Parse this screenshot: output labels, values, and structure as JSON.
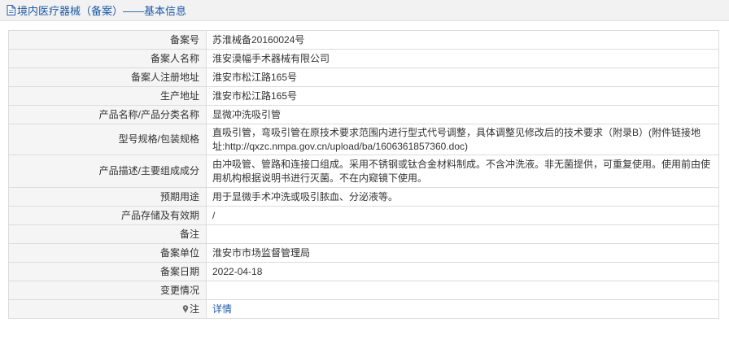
{
  "header": {
    "title": "境内医疗器械（备案）——基本信息"
  },
  "rows": [
    {
      "label": "备案号",
      "value": "苏淮械备20160024号"
    },
    {
      "label": "备案人名称",
      "value": "淮安漠幅手术器械有限公司"
    },
    {
      "label": "备案人注册地址",
      "value": "淮安市松江路165号"
    },
    {
      "label": "生产地址",
      "value": "淮安市松江路165号"
    },
    {
      "label": "产品名称/产品分类名称",
      "value": "显微冲洗吸引管"
    },
    {
      "label": "型号规格/包装规格",
      "value": "直吸引管，弯吸引管在原技术要求范围内进行型式代号调整，具体调整见修改后的技术要求（附录B）(附件链接地址:http://qxzc.nmpa.gov.cn/upload/ba/1606361857360.doc)"
    },
    {
      "label": "产品描述/主要组成成分",
      "value": "由冲吸管、管路和连接口组成。采用不锈钢或钛合金材料制成。不含冲洗液。非无菌提供，可重复使用。使用前由使用机构根据说明书进行灭菌。不在内窥镜下使用。"
    },
    {
      "label": "预期用途",
      "value": "用于显微手术冲洗或吸引脓血、分泌液等。"
    },
    {
      "label": "产品存储及有效期",
      "value": "/"
    },
    {
      "label": "备注",
      "value": ""
    },
    {
      "label": "备案单位",
      "value": "淮安市市场监督管理局"
    },
    {
      "label": "备案日期",
      "value": "2022-04-18"
    },
    {
      "label": "变更情况",
      "value": ""
    },
    {
      "label": "注",
      "value": "详情"
    }
  ],
  "colors": {
    "link": "#1e5aa8",
    "label_bg": "#f5f5f5",
    "border": "#dcdcdc"
  },
  "icons": {
    "header": "document-icon",
    "note": "pin-icon"
  }
}
